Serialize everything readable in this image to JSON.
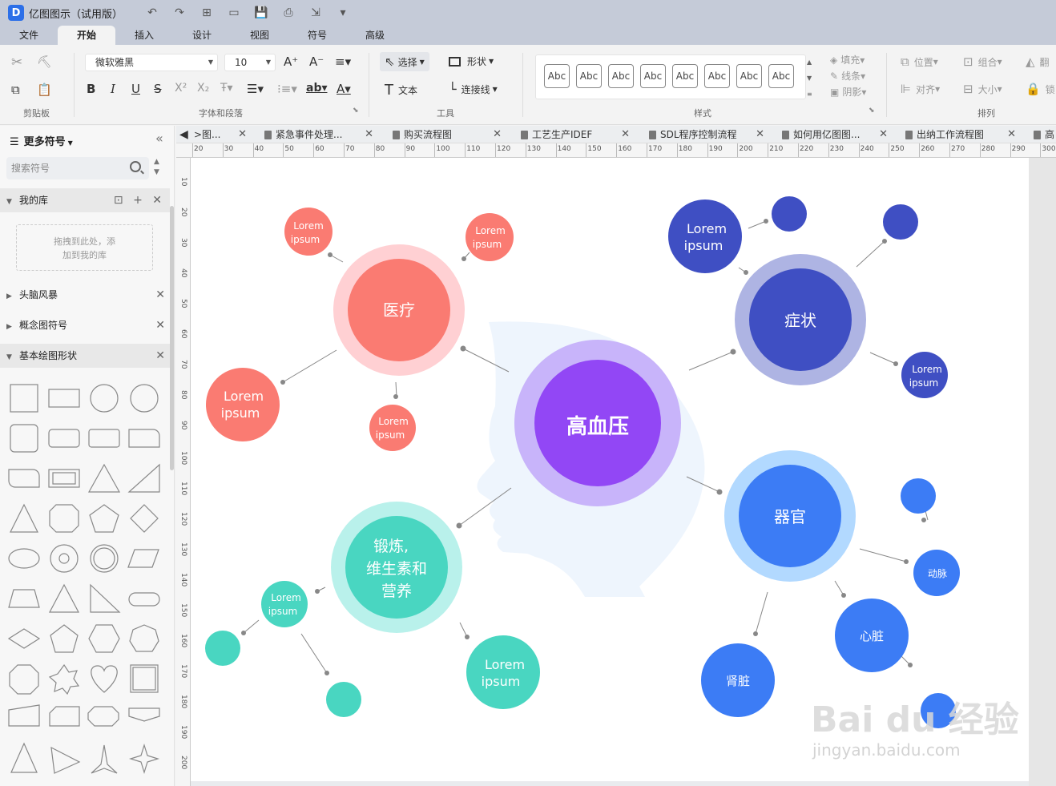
{
  "app": {
    "logo": "D",
    "title": "亿图图示（试用版）"
  },
  "quick_access": [
    "↶",
    "↷",
    "⊞",
    "▭",
    "💾",
    "⎙",
    "⇲",
    "▾"
  ],
  "menu": [
    "文件",
    "开始",
    "插入",
    "设计",
    "视图",
    "符号",
    "高级"
  ],
  "ribbon": {
    "font_name": "微软雅黑",
    "font_size": "10",
    "select_label": "选择",
    "shape_label": "形状",
    "text_label": "文本",
    "connector_label": "连接线",
    "fill_label": "填充",
    "line_label": "线条",
    "shadow_label": "阴影",
    "position_label": "位置",
    "group_label": "组合",
    "align_label": "对齐",
    "size_label": "大小",
    "lock_label": "锁",
    "flip_label": "翻",
    "style_sample": "Abc",
    "groups": {
      "clipboard": "剪贴板",
      "font": "字体和段落",
      "tools": "工具",
      "style": "样式",
      "arrange": "排列"
    }
  },
  "left_panel": {
    "title": "更多符号",
    "search_placeholder": "搜索符号",
    "my_library": "我的库",
    "drop_hint_1": "拖拽到此处，添",
    "drop_hint_2": "加到我的库",
    "sections": [
      "头脑风暴",
      "概念图符号",
      "基本绘图形状"
    ]
  },
  "doc_tabs": [
    ">图...",
    "紧急事件处理...",
    "购买流程图",
    "工艺生产IDEF",
    "SDL程序控制流程",
    "如何用亿图图...",
    "出纳工作流程图",
    "高"
  ],
  "ruler_h": [
    "20",
    "30",
    "40",
    "50",
    "60",
    "70",
    "80",
    "90",
    "100",
    "110",
    "120",
    "130",
    "140",
    "150",
    "160",
    "170",
    "180",
    "190",
    "200",
    "210",
    "220",
    "230",
    "240",
    "250",
    "260",
    "270",
    "280",
    "290",
    "300"
  ],
  "ruler_v": [
    "10",
    "20",
    "30",
    "40",
    "50",
    "60",
    "70",
    "80",
    "90",
    "100",
    "110",
    "120",
    "130",
    "140",
    "150",
    "160",
    "170",
    "180",
    "190",
    "200"
  ],
  "diagram": {
    "center": "高血压",
    "medical": "医疗",
    "symptom": "症状",
    "organ": "器官",
    "exercise": [
      "锻炼,",
      "维生素和",
      "营养"
    ],
    "lorem_1": "Lorem",
    "lorem_2": "ipsum",
    "artery": "动脉",
    "heart": "心脏",
    "kidney": "肾脏",
    "colors": {
      "red": "#fa7b72",
      "red_ring": "#ffd0d3",
      "blue": "#3f4fc3",
      "blue_ring": "#aeb4e3",
      "sky": "#3c7cf5",
      "sky_ring": "#b2d9ff",
      "teal": "#49d6c1",
      "teal_ring": "#b9f1eb",
      "purple": "#9247f5",
      "purple_ring": "#c8b4fa",
      "head": "#eef5fd"
    }
  },
  "watermark": {
    "brand": "Bai du 经验",
    "url": "jingyan.baidu.com"
  }
}
